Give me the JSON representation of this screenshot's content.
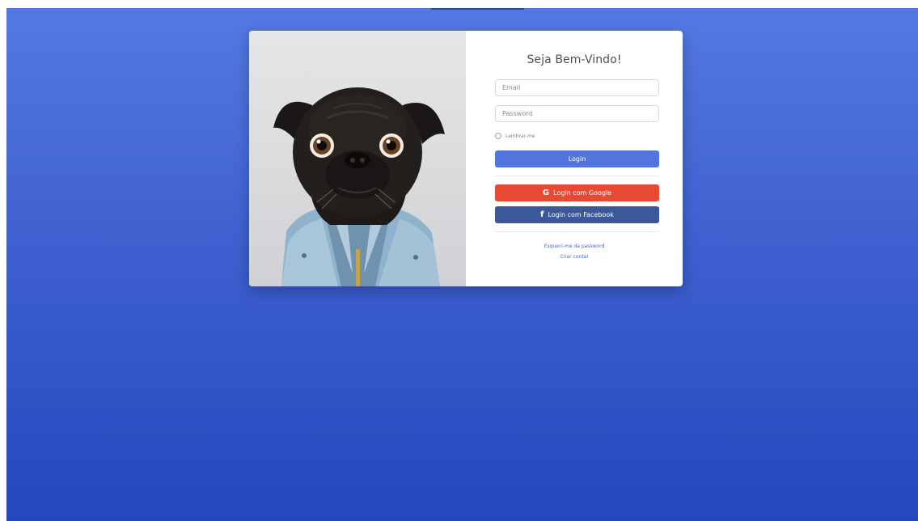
{
  "login": {
    "title": "Seja Bem-Vindo!",
    "email_placeholder": "Email",
    "password_placeholder": "Password",
    "remember_label": "Lembrar-me",
    "login_button": "Login",
    "google_button": "Login com Google",
    "facebook_button": "Login com Facebook",
    "forgot_link": "Esqueci-me da password",
    "create_link": "Criar conta!"
  },
  "icons": {
    "google": "G",
    "facebook": "f"
  },
  "colors": {
    "background_top": "#5479e2",
    "background_bottom": "#2447bd",
    "login_button": "#5175dc",
    "google_button": "#e64a35",
    "facebook_button": "#3b5998",
    "link": "#4468d6"
  }
}
